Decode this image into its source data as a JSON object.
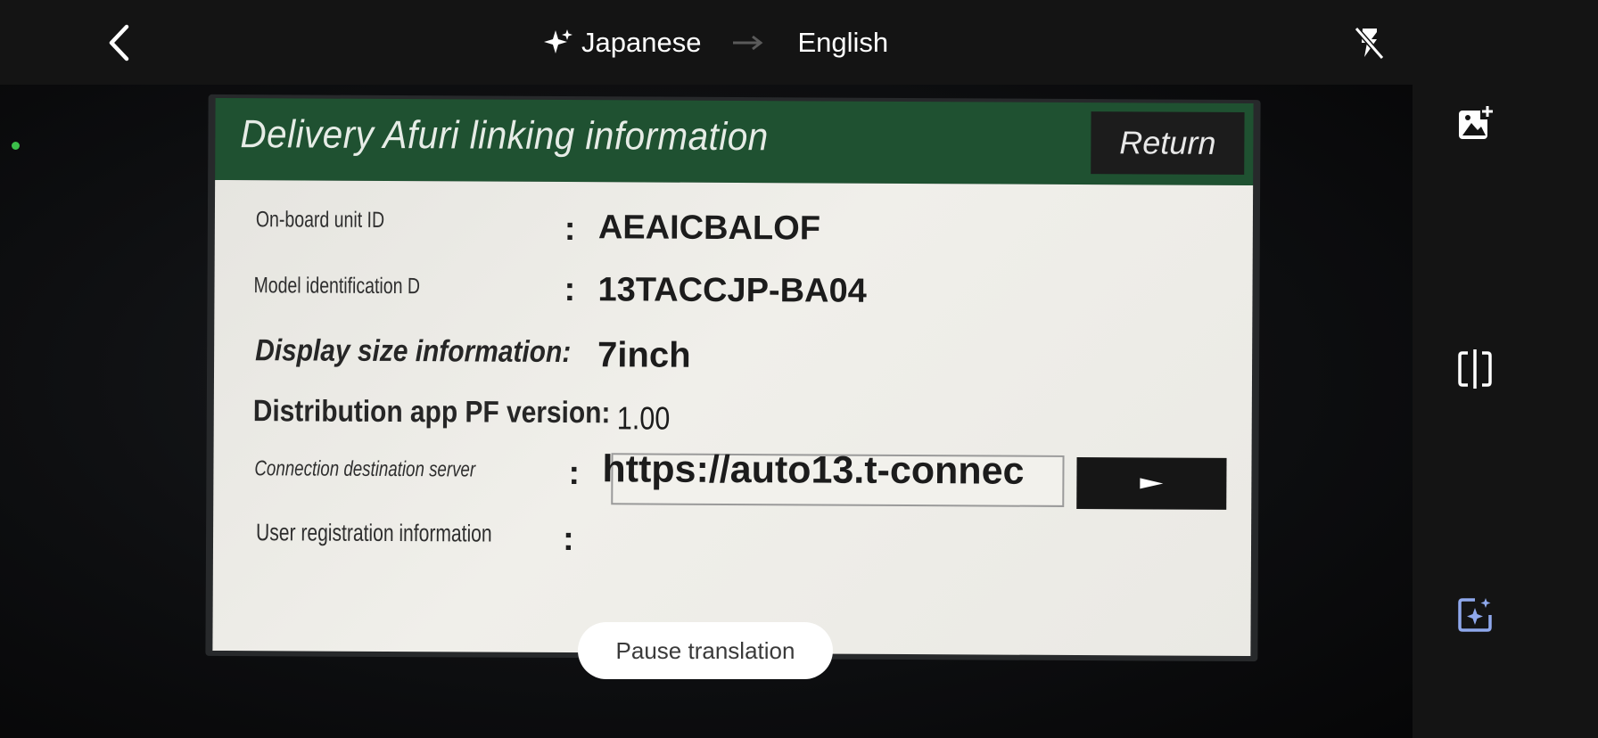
{
  "topbar": {
    "source_language": "Japanese",
    "target_language": "English",
    "icons": {
      "back": "chevron-left-icon",
      "sparkle": "sparkle-icon",
      "arrow": "arrow-right-icon",
      "flash": "flash-off-icon"
    }
  },
  "screen": {
    "title": "Delivery Afuri linking information",
    "return_label": "Return",
    "rows": [
      {
        "label": "On-board unit ID",
        "colon": ":",
        "value": "AEAICBALOF"
      },
      {
        "label": "Model identification D",
        "colon": ":",
        "value": "13TACCJP-BA04"
      },
      {
        "label": "Display size information:",
        "value": "7inch"
      },
      {
        "label": "Distribution app PF version:",
        "value": "1.00"
      },
      {
        "label": "Connection destination server",
        "colon": ":",
        "value": "https://auto13.t-connec"
      },
      {
        "label": "User registration information",
        "colon": ":",
        "value": ""
      }
    ],
    "go_icon": "play-icon",
    "colors": {
      "header": "#1f5131",
      "panel": "#ecebe6"
    }
  },
  "pause_label": "Pause translation",
  "sidebar": {
    "icons": [
      "add-photo-icon",
      "split-view-icon",
      "ai-sparkle-icon"
    ]
  }
}
